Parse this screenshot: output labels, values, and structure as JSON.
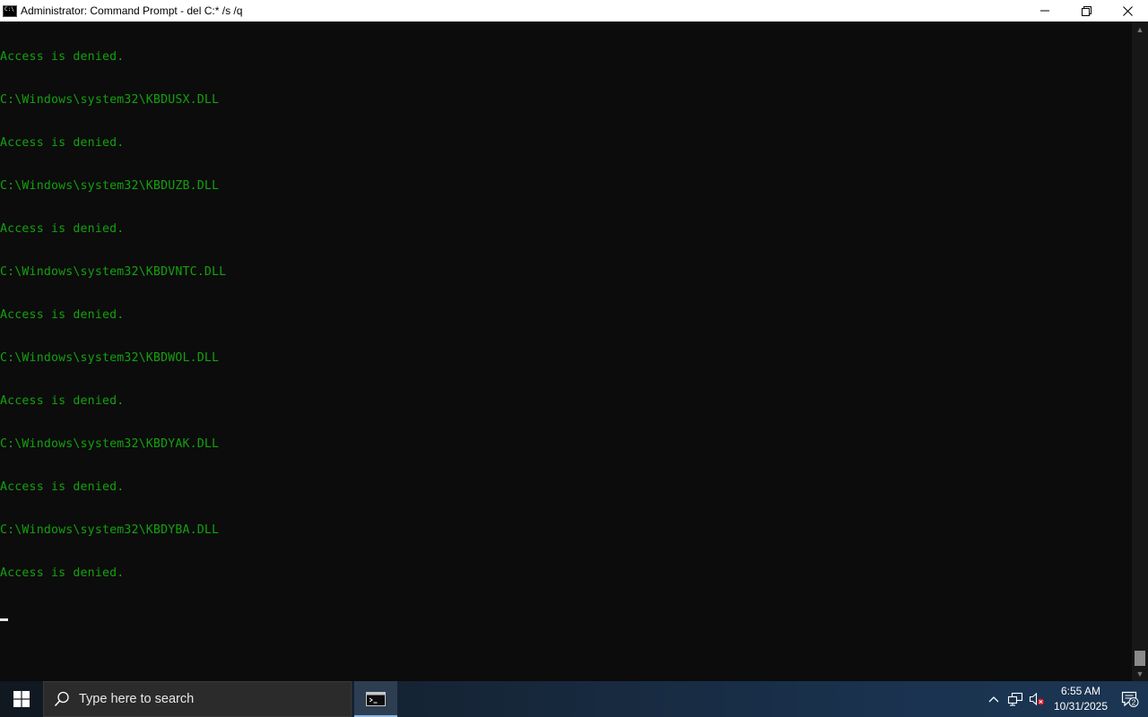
{
  "window": {
    "title": "Administrator: Command Prompt - del  C:* /s /q",
    "icon": "cmd-icon",
    "controls": [
      "minimize-icon",
      "restore-icon",
      "close-icon"
    ]
  },
  "console": {
    "text_color": "#13a10e",
    "background": "#0c0c0c",
    "lines": [
      "Access is denied.",
      "C:\\Windows\\system32\\KBDUSX.DLL",
      "Access is denied.",
      "C:\\Windows\\system32\\KBDUZB.DLL",
      "Access is denied.",
      "C:\\Windows\\system32\\KBDVNTC.DLL",
      "Access is denied.",
      "C:\\Windows\\system32\\KBDWOL.DLL",
      "Access is denied.",
      "C:\\Windows\\system32\\KBDYAK.DLL",
      "Access is denied.",
      "C:\\Windows\\system32\\KBDYBA.DLL",
      "Access is denied."
    ]
  },
  "taskbar": {
    "start_icon": "windows-logo-icon",
    "search_placeholder": "Type here to search",
    "pinned_app": "cmd-icon",
    "tray": {
      "icons": [
        "chevron-up-icon",
        "network-icon",
        "volume-muted-icon"
      ],
      "time": "6:55 AM",
      "date": "10/31/2025",
      "notification_count": "2"
    }
  }
}
